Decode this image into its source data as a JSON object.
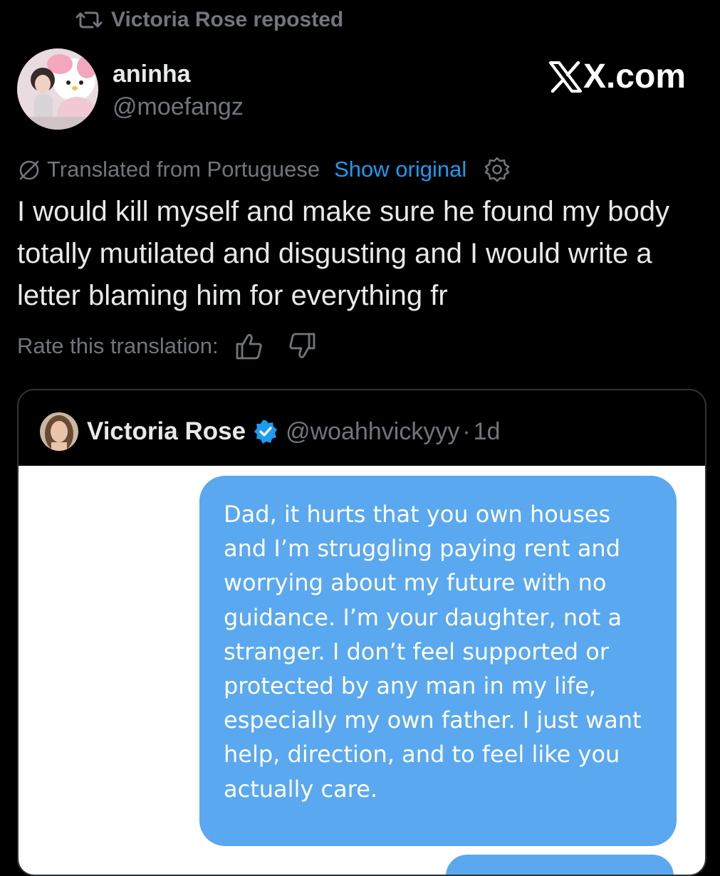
{
  "repost": {
    "text": "Victoria Rose reposted",
    "icon": "repost-icon"
  },
  "post": {
    "display_name": "aninha",
    "handle": "@moefangz",
    "avatar_icon": "avatar-image",
    "brand": "X.com",
    "translation": {
      "label": "Translated from Portuguese",
      "show_original": "Show original",
      "settings_icon": "gear-icon"
    },
    "text": "I would kill myself and make sure he found my body totally mutilated and disgusting and I would write a letter blaming him for everything fr",
    "rate": {
      "label": "Rate this translation:",
      "up_icon": "thumbs-up-icon",
      "down_icon": "thumbs-down-icon"
    }
  },
  "quote": {
    "display_name": "Victoria Rose",
    "verified_icon": "verified-badge-icon",
    "handle": "@woahhvickyyy",
    "separator": "·",
    "time": "1d",
    "image": {
      "message": "Dad, it hurts that you own houses and I’m struggling paying rent and worrying about my future with no guidance. I’m your daughter, not a stranger. I don’t feel supported or protected by any man in my life, especially my own father. I just want help, direction, and to feel like you actually care."
    }
  },
  "colors": {
    "background": "#000000",
    "primary_text": "#e7e9ea",
    "secondary_text": "#71767b",
    "link": "#1d9bf0",
    "bubble": "#5aa8ef",
    "verified": "#1d9bf0"
  }
}
